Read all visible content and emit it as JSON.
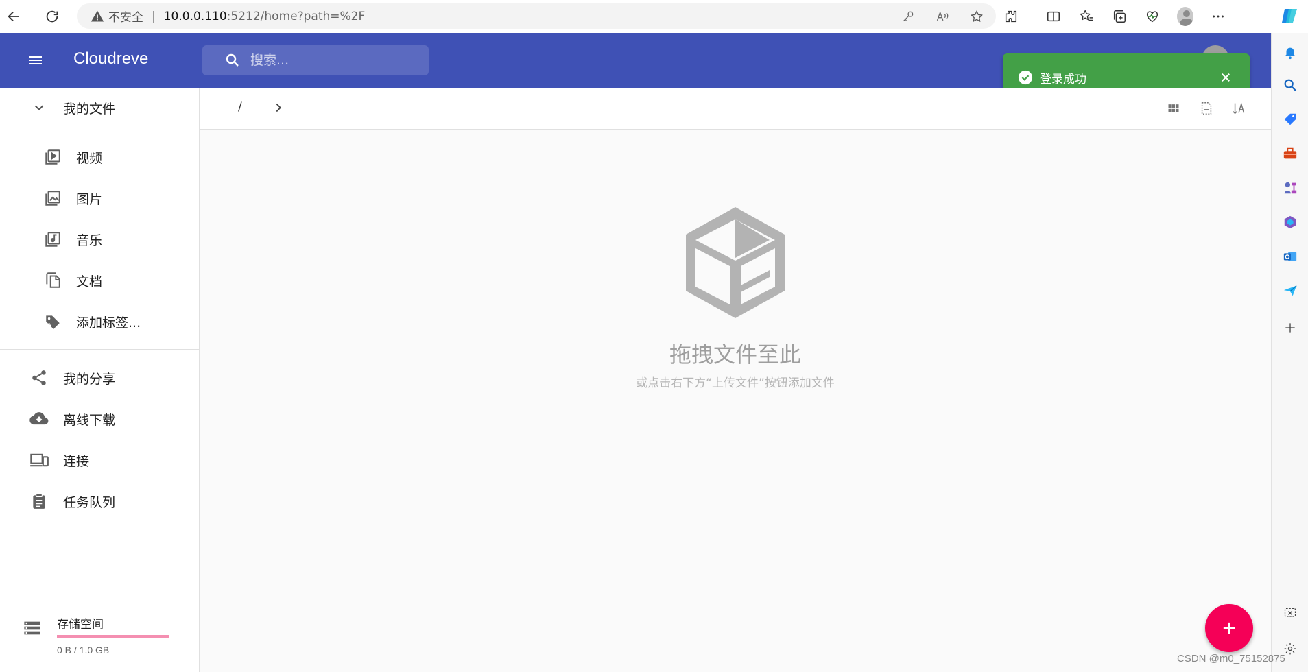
{
  "browser": {
    "security_label": "不安全",
    "url_host": "10.0.0.110",
    "url_path": ":5212/home?path=%2F"
  },
  "app": {
    "title": "Cloudreve",
    "header_color": "#3f51b5",
    "search_placeholder": "搜索..."
  },
  "toast": {
    "message": "登录成功",
    "color": "#43a047"
  },
  "drawer": {
    "my_files": "我的文件",
    "categories": [
      {
        "label": "视频",
        "icon": "video-library-icon"
      },
      {
        "label": "图片",
        "icon": "photo-library-icon"
      },
      {
        "label": "音乐",
        "icon": "music-library-icon"
      },
      {
        "label": "文档",
        "icon": "documents-icon"
      },
      {
        "label": "添加标签...",
        "icon": "add-tag-icon"
      }
    ],
    "nav": [
      {
        "label": "我的分享",
        "icon": "share-icon"
      },
      {
        "label": "离线下载",
        "icon": "cloud-download-icon"
      },
      {
        "label": "连接",
        "icon": "devices-icon"
      },
      {
        "label": "任务队列",
        "icon": "task-clipboard-icon"
      }
    ],
    "storage": {
      "title": "存储空间",
      "value": "0 B / 1.0 GB",
      "used_fraction": 0,
      "bar_color": "#f48fb1"
    }
  },
  "main": {
    "breadcrumb_root": "/",
    "empty_title": "拖拽文件至此",
    "empty_subtitle": "或点击右下方“上传文件”按钮添加文件",
    "fab_color": "#f50057"
  },
  "watermark": "CSDN @m0_75152875"
}
